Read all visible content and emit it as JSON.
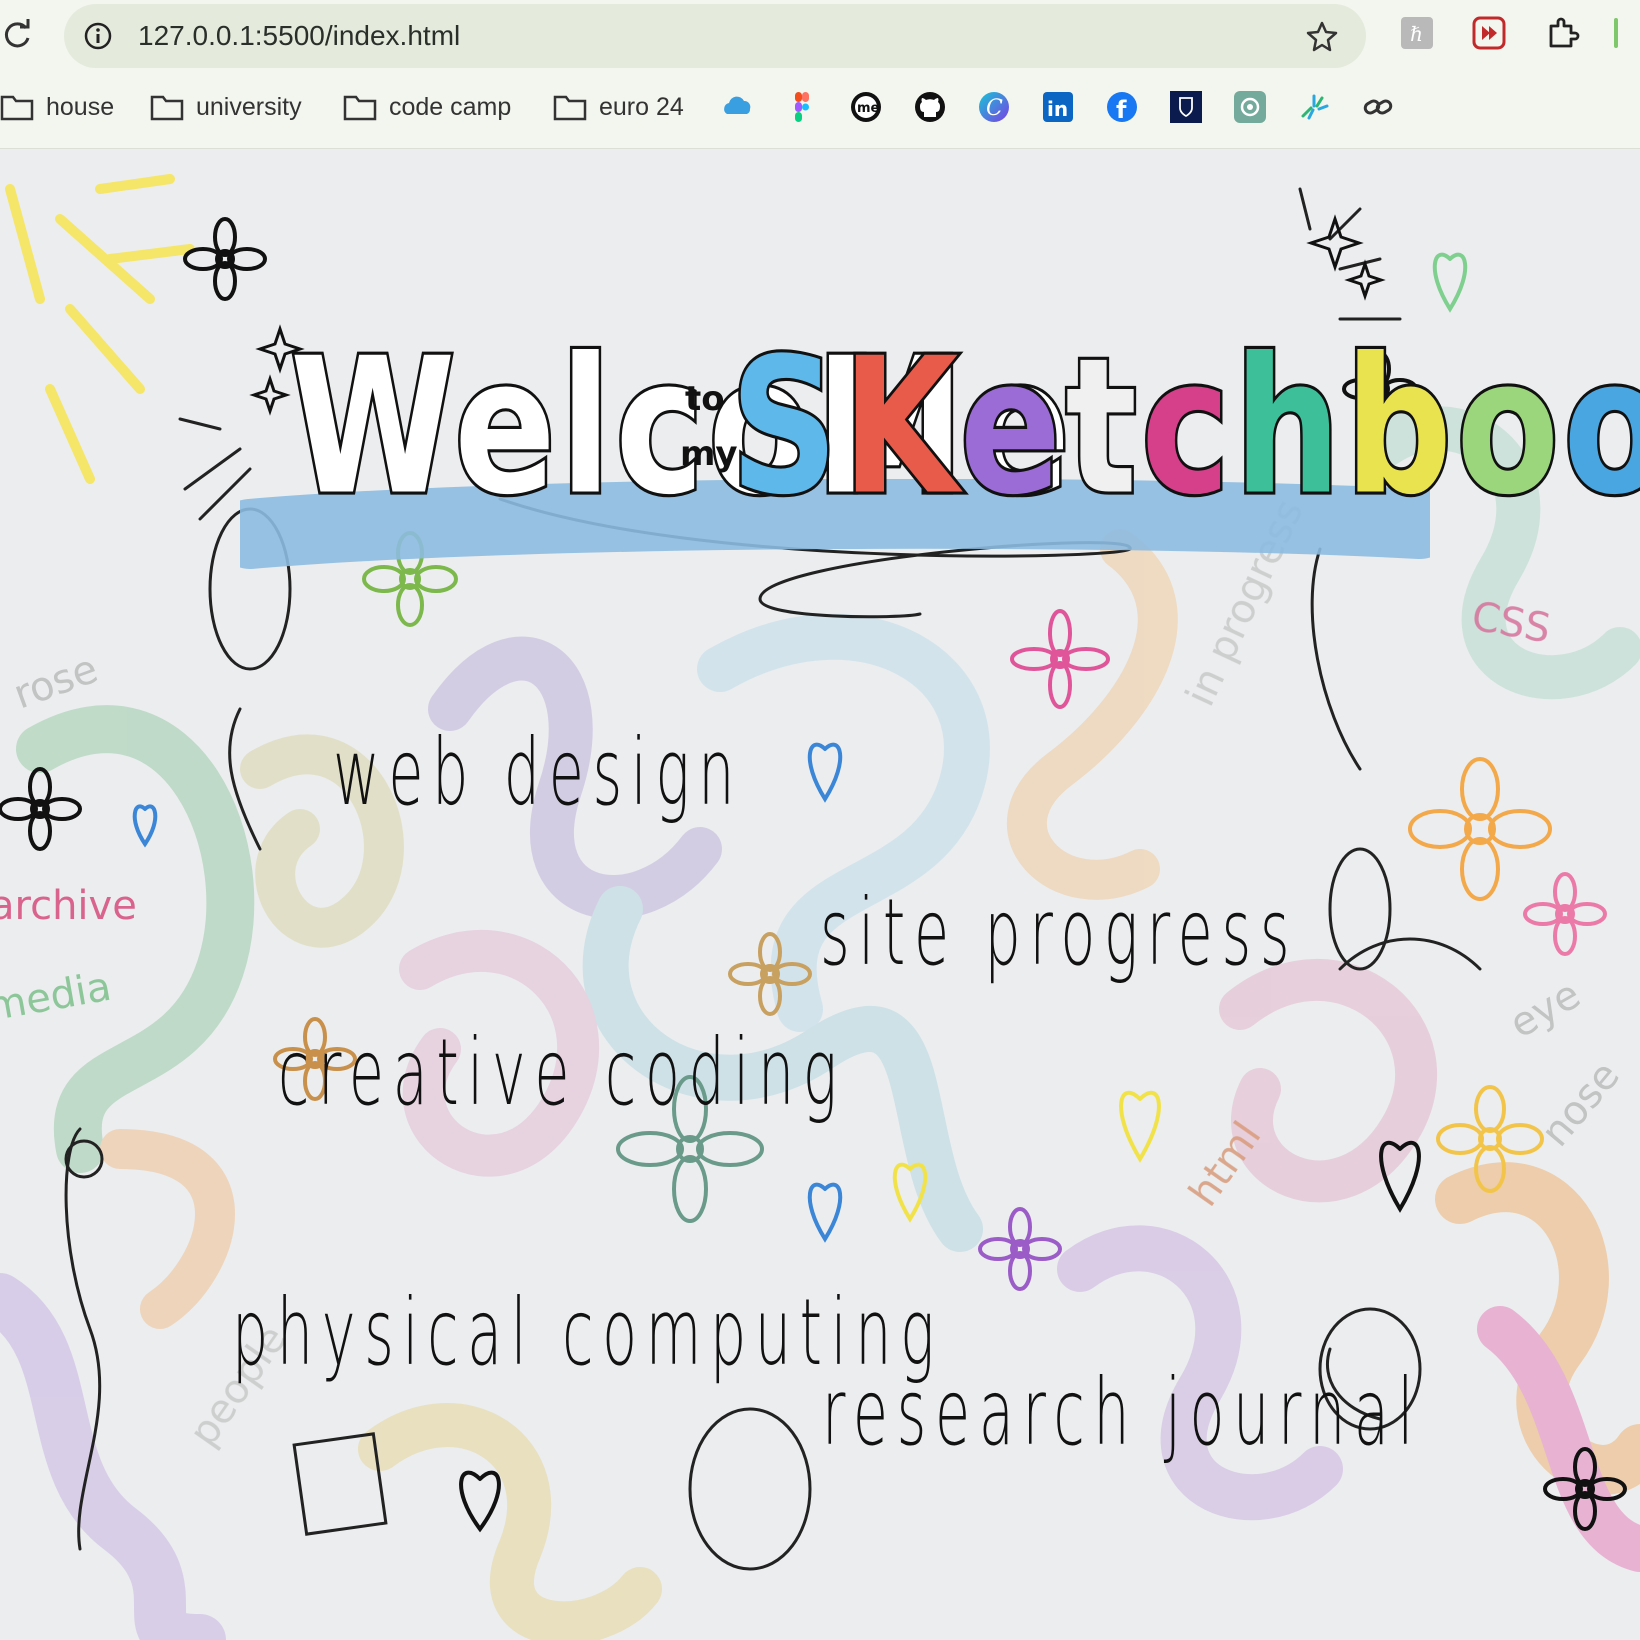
{
  "browser": {
    "url": "127.0.0.1:5500/index.html",
    "icons": {
      "reload": "reload-icon",
      "site_info": "info-icon",
      "bookmark_star": "star-icon",
      "extensions": [
        "extension-r-icon",
        "extension-video-icon",
        "puzzle-icon"
      ]
    },
    "bookmarks": {
      "folders": [
        {
          "label": "house"
        },
        {
          "label": "university"
        },
        {
          "label": "code camp"
        },
        {
          "label": "euro 24"
        }
      ],
      "icons": [
        "cloud-icon",
        "figma-icon",
        "me-icon",
        "github-icon",
        "c-icon",
        "linkedin-icon",
        "facebook-icon",
        "crest-icon",
        "chatgpt-icon",
        "sparkle-icon",
        "link-icon"
      ]
    }
  },
  "page": {
    "title": {
      "welcome": "WelcoMe",
      "to": "to",
      "my": "my",
      "sketchbook": "SKetchbooK"
    },
    "colors": {
      "title_underline": "#8dbbe0",
      "sketch_letters": [
        "#5fb8ea",
        "#e85a4a",
        "#9b6bd6",
        "#f0f0f0",
        "#d63f8a",
        "#3dbf9a",
        "#e9e34f",
        "#9bd67c",
        "#4aa6e0",
        "#e8a04a",
        "#e84a6a"
      ]
    },
    "links": [
      {
        "label": "web design"
      },
      {
        "label": "site progress"
      },
      {
        "label": "creative coding"
      },
      {
        "label": "physical computing"
      },
      {
        "label": "research journal"
      }
    ],
    "doodle_labels": [
      "rose",
      "archive",
      "media",
      "in progress",
      "CSS",
      "eye",
      "nose",
      "html",
      "people"
    ]
  }
}
